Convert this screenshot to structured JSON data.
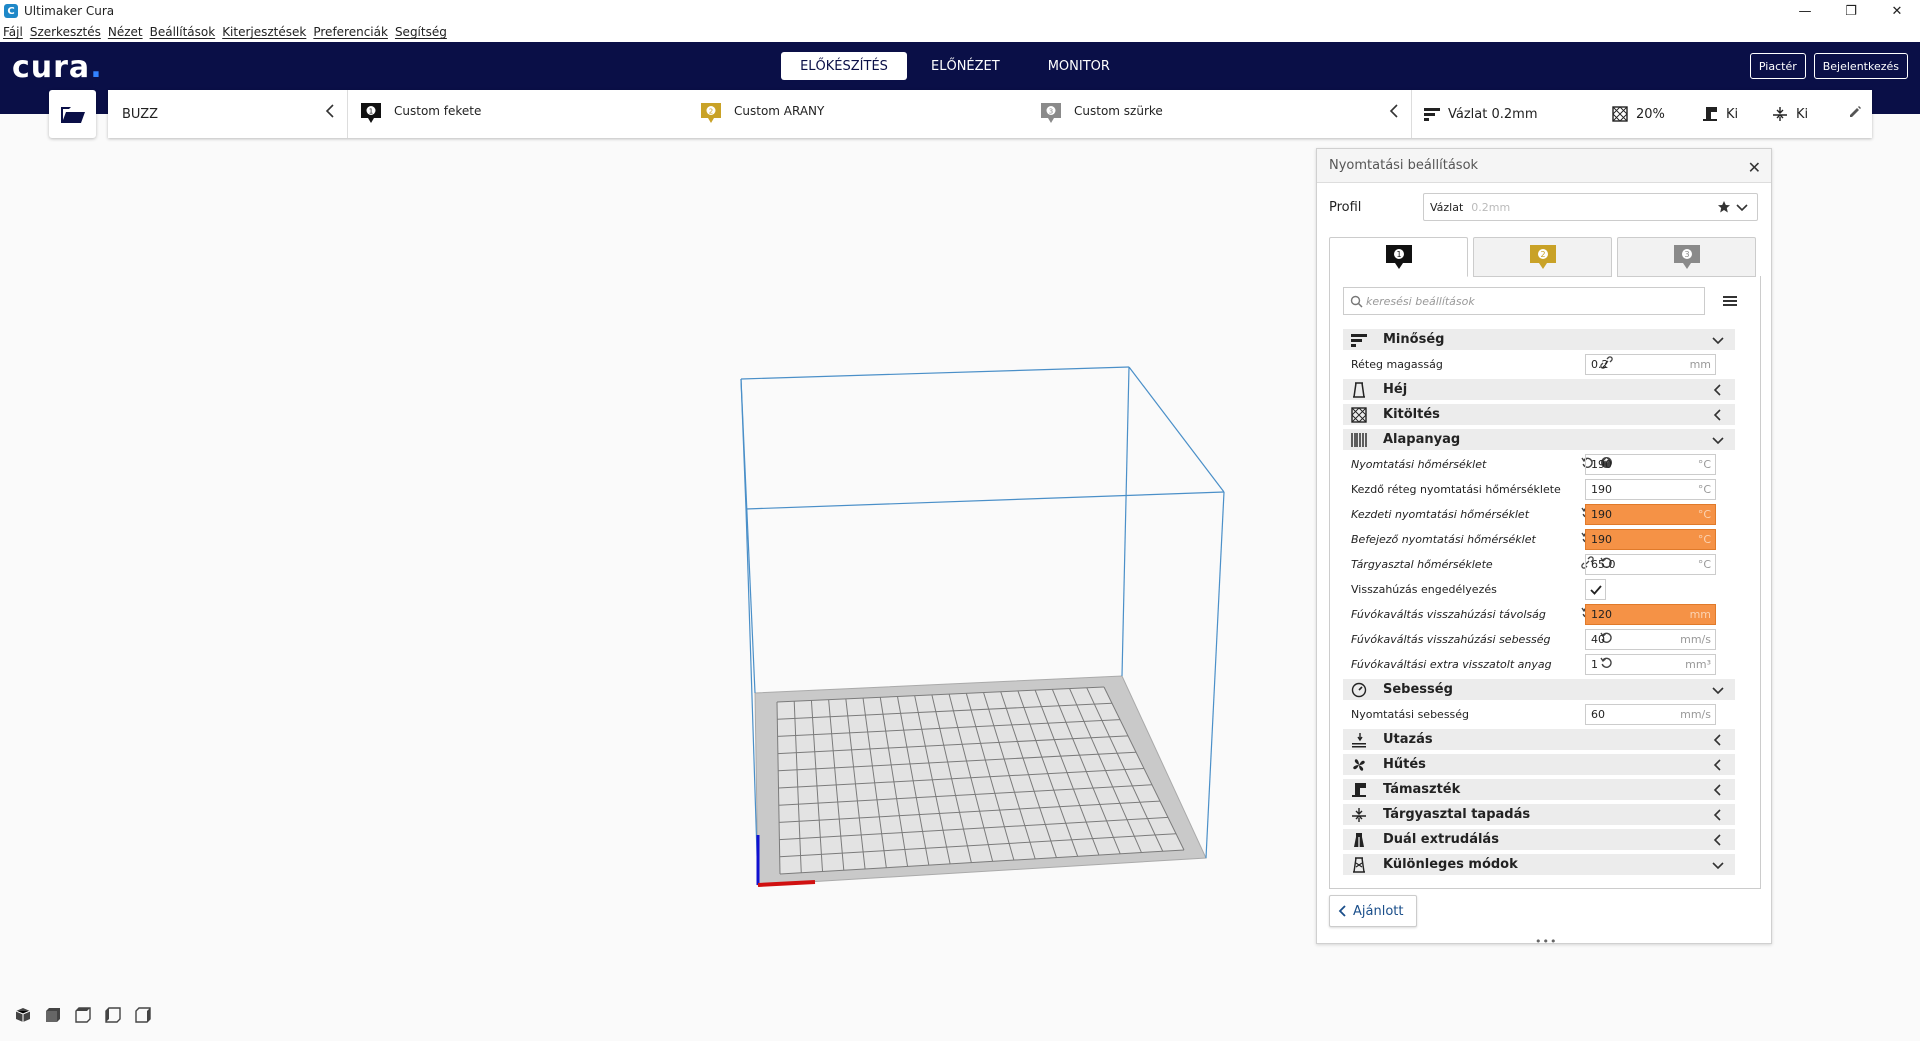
{
  "window": {
    "title": "Ultimaker Cura",
    "app_icon": "cura-app-icon",
    "controls": [
      "minimize",
      "restore",
      "close"
    ]
  },
  "menu": {
    "items": [
      "Fájl",
      "Szerkesztés",
      "Nézet",
      "Beállítások",
      "Kiterjesztések",
      "Preferenciák",
      "Segítség"
    ]
  },
  "header": {
    "logo": "cura",
    "stages": [
      "ELŐKÉSZÍTÉS",
      "ELŐNÉZET",
      "MONITOR"
    ],
    "active_stage": "ELŐKÉSZÍTÉS",
    "marketplace": "Piactér",
    "signin": "Bejelentkezés"
  },
  "printer_bar": {
    "machine": "BUZZ",
    "extruders": [
      {
        "number": "1",
        "name": "Custom fekete",
        "color": "#111111"
      },
      {
        "number": "2",
        "name": "Custom ARANY",
        "color": "#c9a227"
      },
      {
        "number": "3",
        "name": "Custom szürke",
        "color": "#8a8a8a"
      }
    ],
    "profile_summary": "Vázlat 0.2mm",
    "infill": "20%",
    "support": "Ki",
    "adhesion": "Ki"
  },
  "settings_panel": {
    "title": "Nyomtatási beállítások",
    "profile_label": "Profil",
    "profile_name": "Vázlat",
    "profile_sub": "0.2mm",
    "extruder_tabs": [
      "1",
      "2",
      "3"
    ],
    "search_placeholder": "keresési beállítások",
    "recommended": "Ajánlott",
    "categories": [
      {
        "label": "Minőség",
        "icon": "quality-icon",
        "expanded": true
      },
      {
        "label": "Héj",
        "icon": "shell-icon",
        "expanded": false
      },
      {
        "label": "Kitöltés",
        "icon": "infill-icon",
        "expanded": false
      },
      {
        "label": "Alapanyag",
        "icon": "material-icon",
        "expanded": true
      },
      {
        "label": "Sebesség",
        "icon": "speed-icon",
        "expanded": true
      },
      {
        "label": "Utazás",
        "icon": "travel-icon",
        "expanded": false
      },
      {
        "label": "Hűtés",
        "icon": "cooling-icon",
        "expanded": false
      },
      {
        "label": "Támaszték",
        "icon": "support-icon",
        "expanded": false
      },
      {
        "label": "Tárgyasztal tapadás",
        "icon": "adhesion-icon",
        "expanded": false
      },
      {
        "label": "Duál extrudálás",
        "icon": "dual-extrusion-icon",
        "expanded": false
      },
      {
        "label": "Különleges módok",
        "icon": "special-modes-icon",
        "expanded": true
      }
    ],
    "settings": {
      "layer_height": {
        "label": "Réteg magasság",
        "value": "0.2",
        "unit": "mm"
      },
      "print_temp": {
        "label": "Nyomtatási hőmérséklet",
        "value": "190",
        "unit": "°C"
      },
      "initial_layer_temp": {
        "label": "Kezdő réteg nyomtatási hőmérséklete",
        "value": "190",
        "unit": "°C"
      },
      "initial_print_temp": {
        "label": "Kezdeti nyomtatási hőmérséklet",
        "value": "190",
        "unit": "°C"
      },
      "final_print_temp": {
        "label": "Befejező nyomtatási hőmérséklet",
        "value": "190",
        "unit": "°C"
      },
      "bed_temp": {
        "label": "Tárgyasztal hőmérséklete",
        "value": "65.0",
        "unit": "°C"
      },
      "retraction_enable": {
        "label": "Visszahúzás engedélyezés",
        "checked": true
      },
      "switch_retract_dist": {
        "label": "Fúvókaváltás visszahúzási távolság",
        "value": "120",
        "unit": "mm"
      },
      "switch_retract_speed": {
        "label": "Fúvókaváltás visszahúzási sebesség",
        "value": "40",
        "unit": "mm/s"
      },
      "switch_extra_prime": {
        "label": "Fúvókaváltási extra visszatolt anyag",
        "value": "1",
        "unit": "mm³"
      },
      "print_speed": {
        "label": "Nyomtatási sebesség",
        "value": "60",
        "unit": "mm/s"
      }
    }
  },
  "colors": {
    "header_bg": "#0a0f47",
    "accent_blue": "#3282ff",
    "error_orange": "#f59246",
    "category_bg": "#ececec"
  }
}
